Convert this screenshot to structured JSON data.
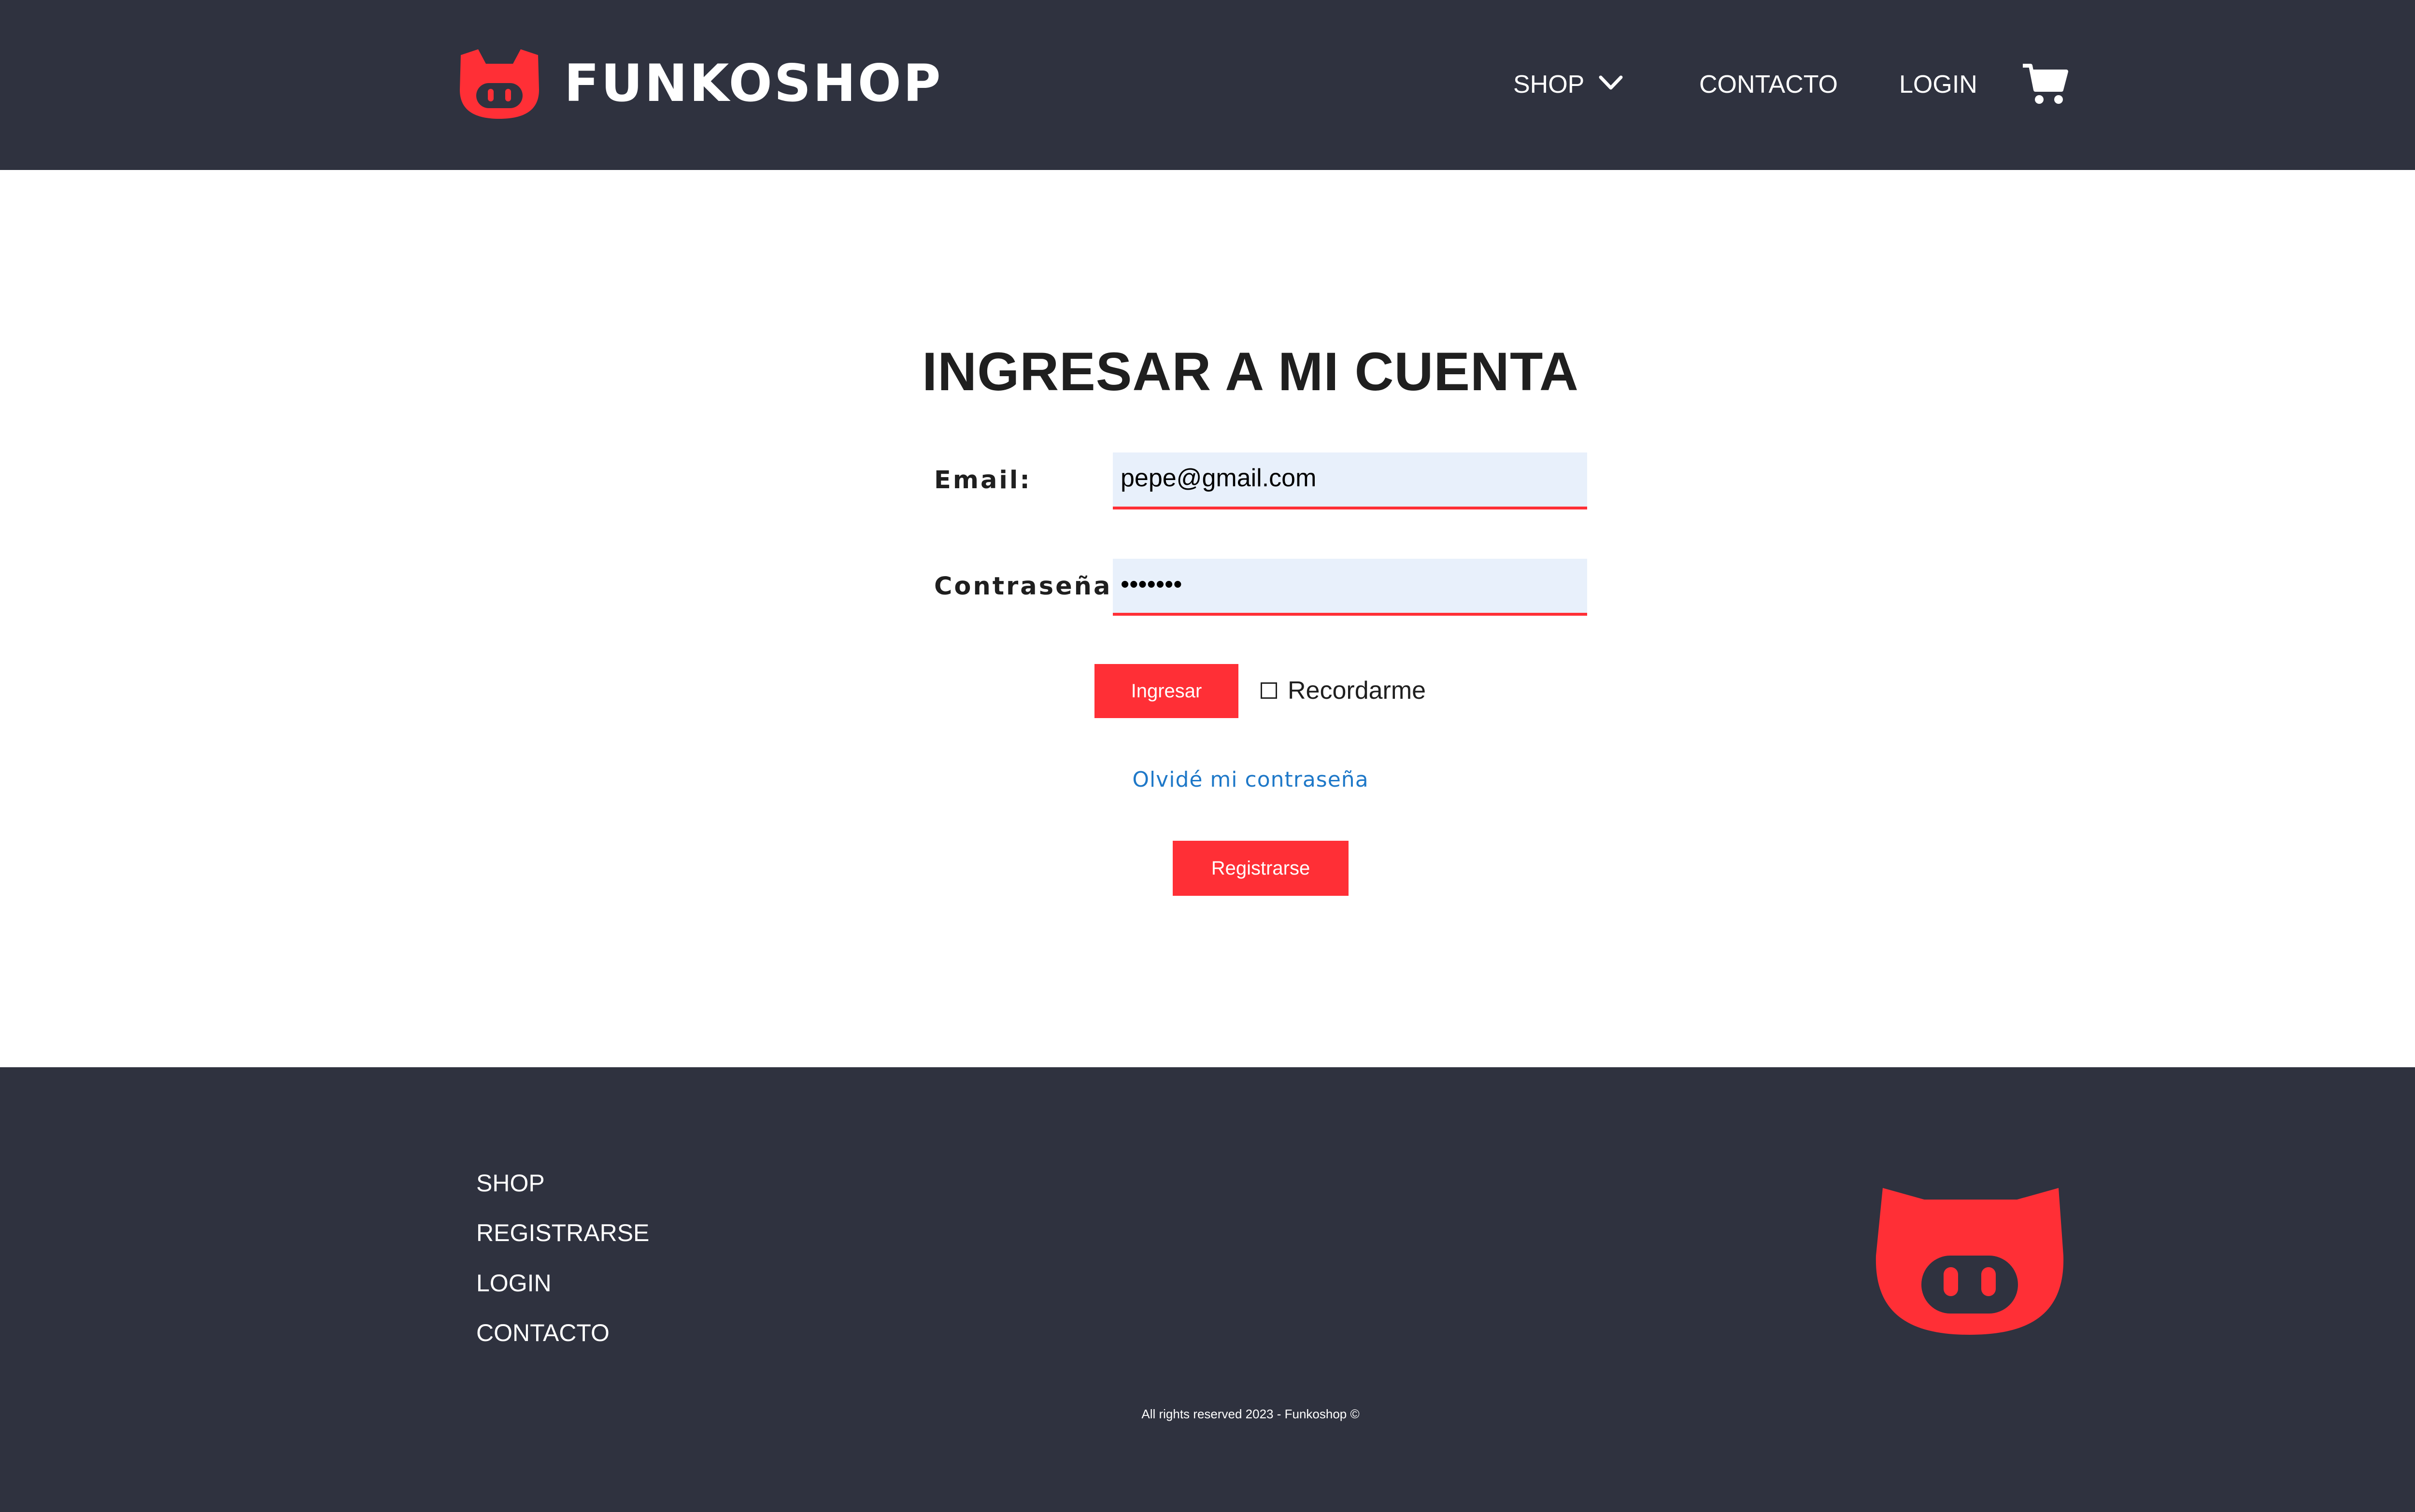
{
  "header": {
    "brand": "FUNKOSHOP",
    "nav": {
      "shop": "SHOP",
      "contacto": "CONTACTO",
      "login": "LOGIN"
    }
  },
  "login_form": {
    "title": "INGRESAR A MI CUENTA",
    "email_label": "Email:",
    "email_value": "pepe@gmail.com",
    "password_label": "Contraseña:",
    "password_value": "•••••••",
    "submit_label": "Ingresar",
    "remember_label": "Recordarme",
    "remember_checked": false,
    "forgot_link": "Olvidé mi contraseña",
    "register_label": "Registrarse"
  },
  "footer": {
    "links": [
      "SHOP",
      "REGISTRARSE",
      "LOGIN",
      "CONTACTO"
    ],
    "copyright": "All rights reserved 2023 - Funkoshop ©"
  },
  "colors": {
    "header_bg": "#2f323f",
    "accent": "#ff2f36",
    "input_bg": "#e8f0fb",
    "link": "#1e78c8",
    "text": "#1f1f1f"
  },
  "icons": {
    "logo": "funko-cat-logo-icon",
    "nav_dropdown": "chevron-down-icon",
    "cart": "shopping-cart-icon",
    "footer_logo": "funko-cat-logo-icon"
  }
}
